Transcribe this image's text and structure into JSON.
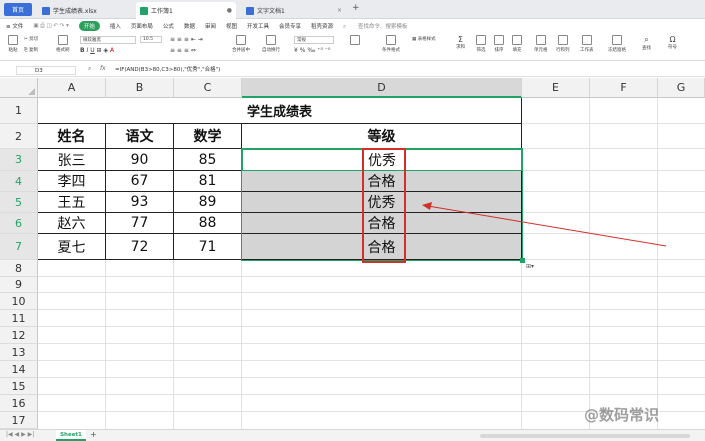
{
  "tabs": {
    "home": "首页",
    "doc1": "学生成绩表.xlsx",
    "doc2": "工作簿1",
    "doc3": "文字文档1",
    "new_tab": "+"
  },
  "menu": {
    "file": "≡ 文件",
    "start": "开始",
    "insert": "插入",
    "page_layout": "页面布局",
    "formula": "公式",
    "data": "数据",
    "review": "审阅",
    "view": "视图",
    "dev": "开发工具",
    "member": "会员专享",
    "features": "稻壳资源",
    "search": "查找命令、搜索模板"
  },
  "ribbon": {
    "format_painter": "格式刷",
    "paste": "粘贴",
    "cut": "剪切",
    "copy": "复制",
    "font": "微软雅黑",
    "font_size": "10.5",
    "merge": "合并居中",
    "wrap": "自动换行",
    "number_format": "常规",
    "cond_format": "条件格式",
    "table_style": "表格样式",
    "sum": "求和",
    "filter": "筛选",
    "sort": "排序",
    "fill": "填充",
    "cell": "单元格",
    "row_col": "行和列",
    "worksheet": "工作表",
    "freeze": "冻结窗格",
    "find": "查找",
    "symbol": "符号"
  },
  "formula_bar": {
    "name_box": "D3",
    "fx": "fx",
    "formula": "=IF(AND(B3>80,C3>80),\"优秀\",\"合格\")"
  },
  "columns": [
    "A",
    "B",
    "C",
    "D",
    "E",
    "F",
    "G"
  ],
  "rows": [
    "1",
    "2",
    "3",
    "4",
    "5",
    "6",
    "7",
    "8",
    "9",
    "10",
    "11",
    "12",
    "13",
    "14",
    "15",
    "16",
    "17"
  ],
  "table": {
    "title": "学生成绩表",
    "headers": [
      "姓名",
      "语文",
      "数学",
      "等级"
    ],
    "records": [
      {
        "name": "张三",
        "chinese": "90",
        "math": "85",
        "grade": "优秀"
      },
      {
        "name": "李四",
        "chinese": "67",
        "math": "81",
        "grade": "合格"
      },
      {
        "name": "王五",
        "chinese": "93",
        "math": "89",
        "grade": "优秀"
      },
      {
        "name": "赵六",
        "chinese": "77",
        "math": "88",
        "grade": "合格"
      },
      {
        "name": "夏七",
        "chinese": "72",
        "math": "71",
        "grade": "合格"
      }
    ]
  },
  "sheet_tab": "Sheet1",
  "add_sheet": "+",
  "watermark": "@数码常识",
  "colors": {
    "accent": "#21a366",
    "highlight_box": "#d0302a",
    "selection_fill": "#d4d4d4"
  }
}
